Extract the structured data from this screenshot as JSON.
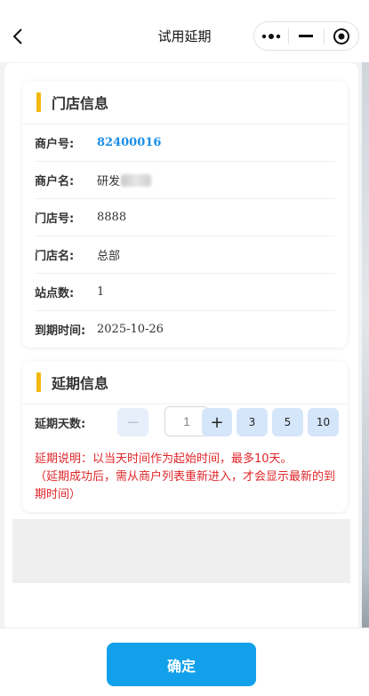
{
  "navbar": {
    "title": "试用延期",
    "back_icon": "chevron-left-icon",
    "more_icon": "more-dots-icon",
    "minimize_icon": "minimize-icon",
    "close_icon": "target-close-icon"
  },
  "store_info": {
    "title": "门店信息",
    "merchant_no_label": "商户号:",
    "merchant_no": "82400016",
    "merchant_name_label": "商户名:",
    "merchant_name": "研发",
    "store_no_label": "门店号:",
    "store_no": "8888",
    "store_name_label": "门店名:",
    "store_name": "总部",
    "site_count_label": "站点数:",
    "site_count": "1",
    "expire_label": "到期时间:",
    "expire_date": "2025-10-26"
  },
  "extend_info": {
    "title": "延期信息",
    "days_label": "延期天数:",
    "minus_label": "−",
    "days_value": "1",
    "plus_label": "+",
    "preset_3": "3",
    "preset_5": "5",
    "preset_10": "10",
    "note_line1": "延期说明：以当天时间作为起始时间，最多10天。",
    "note_line2": "（延期成功后，需从商户列表重新进入，才会显示最新的到期时间）"
  },
  "footer": {
    "confirm_label": "确定"
  },
  "colors": {
    "accent_bar": "#f5b80f",
    "link": "#1a8ee8",
    "note_red": "#e0262a",
    "confirm_bg": "#12a0eb",
    "stepper_bg": "#d5e6fb"
  }
}
